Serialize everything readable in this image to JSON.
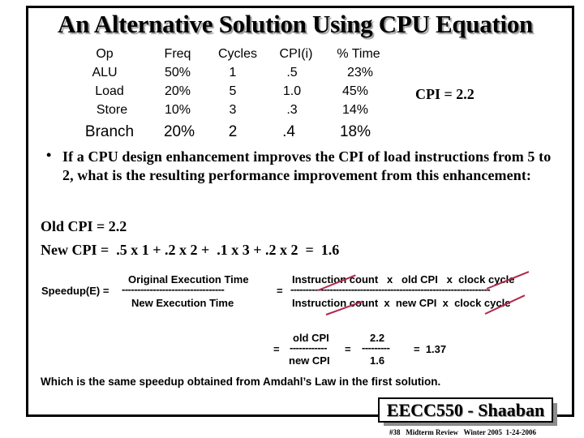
{
  "slide": {
    "title": "An Alternative Solution Using CPU Equation",
    "table": {
      "headers": [
        "Op",
        "Freq",
        "Cycles",
        "CPI(i)",
        "% Time"
      ],
      "rows": [
        {
          "op": "ALU",
          "freq": "50%",
          "cycles": "1",
          "cpi": ".5",
          "time": "23%"
        },
        {
          "op": "Load",
          "freq": "20%",
          "cycles": "5",
          "cpi": "1.0",
          "time": "45%"
        },
        {
          "op": "Store",
          "freq": "10%",
          "cycles": "3",
          "cpi": ".3",
          "time": "14%"
        },
        {
          "op": "Branch",
          "freq": "20%",
          "cycles": "2",
          "cpi": ".4",
          "time": "18%"
        }
      ]
    },
    "cpi_total": "CPI = 2.2",
    "bullet_symbol": "•",
    "question": "If a CPU design enhancement improves the CPI of load instructions from 5 to 2,  what is the resulting performance improvement from this enhancement:",
    "old_cpi": "Old CPI = 2.2",
    "new_cpi": "New CPI =  .5 x 1 + .2 x 2 +  .1 x 3 + .2 x 2  =  1.6",
    "speedup": {
      "label": "Speedup(E) =",
      "numerator": "Original Execution Time",
      "divider": "---------------------------------",
      "denominator": "New Execution Time",
      "eq": "=",
      "expanded_numerator": "Instruction count   x   old CPI   x  clock cycle",
      "expanded_divider": "------------------------------------------------------------------",
      "expanded_denominator": "Instruction count  x  new CPI  x  clock cycle",
      "ratio_eq1": "=",
      "ratio_numerator": "old CPI",
      "ratio_divider": "------------",
      "ratio_denominator": "new CPI",
      "ratio_eq2": "=",
      "value_numerator": "2.2",
      "value_divider": "---------",
      "value_denominator": "1.6",
      "result": "=  1.37"
    },
    "note": "Which is the same speedup obtained from Amdahl’s Law in the first solution.",
    "footer": {
      "course": "EECC550 - Shaaban",
      "subtitle": "#38   Midterm Review   Winter 2005  1-24-2006"
    }
  }
}
